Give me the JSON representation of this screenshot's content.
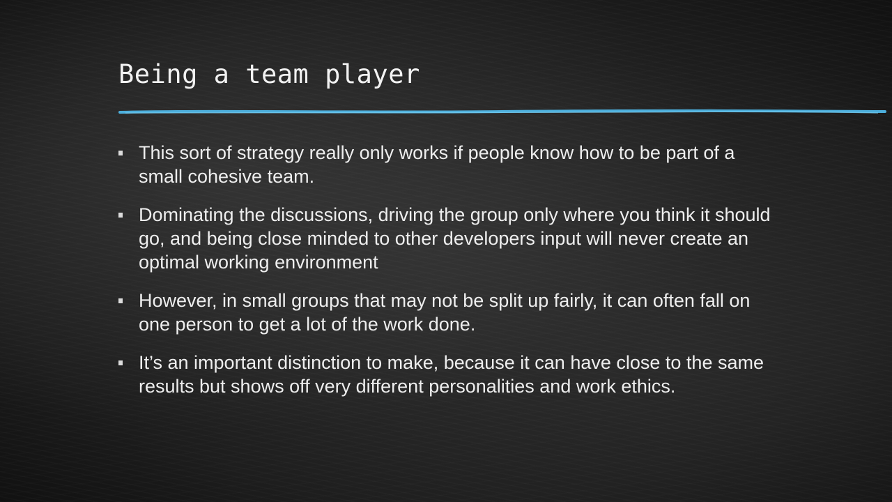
{
  "slide": {
    "title": "Being a team player",
    "accent_color": "#4fb6e6",
    "background_color": "#1f1f1f",
    "text_color": "#eeeeee",
    "bullets": [
      {
        "text": "This sort of strategy really only works if people know how to be part of a small cohesive team."
      },
      {
        "text": "Dominating the discussions, driving the group only where you think it should go, and being close minded to other developers input will never create an optimal working environment"
      },
      {
        "text": "However, in small groups that may not be split up fairly, it can often fall on one person to get a lot of the work done."
      },
      {
        "text": "It’s an important distinction to make, because it can have close to the same results but shows off very different personalities and work ethics."
      }
    ]
  }
}
